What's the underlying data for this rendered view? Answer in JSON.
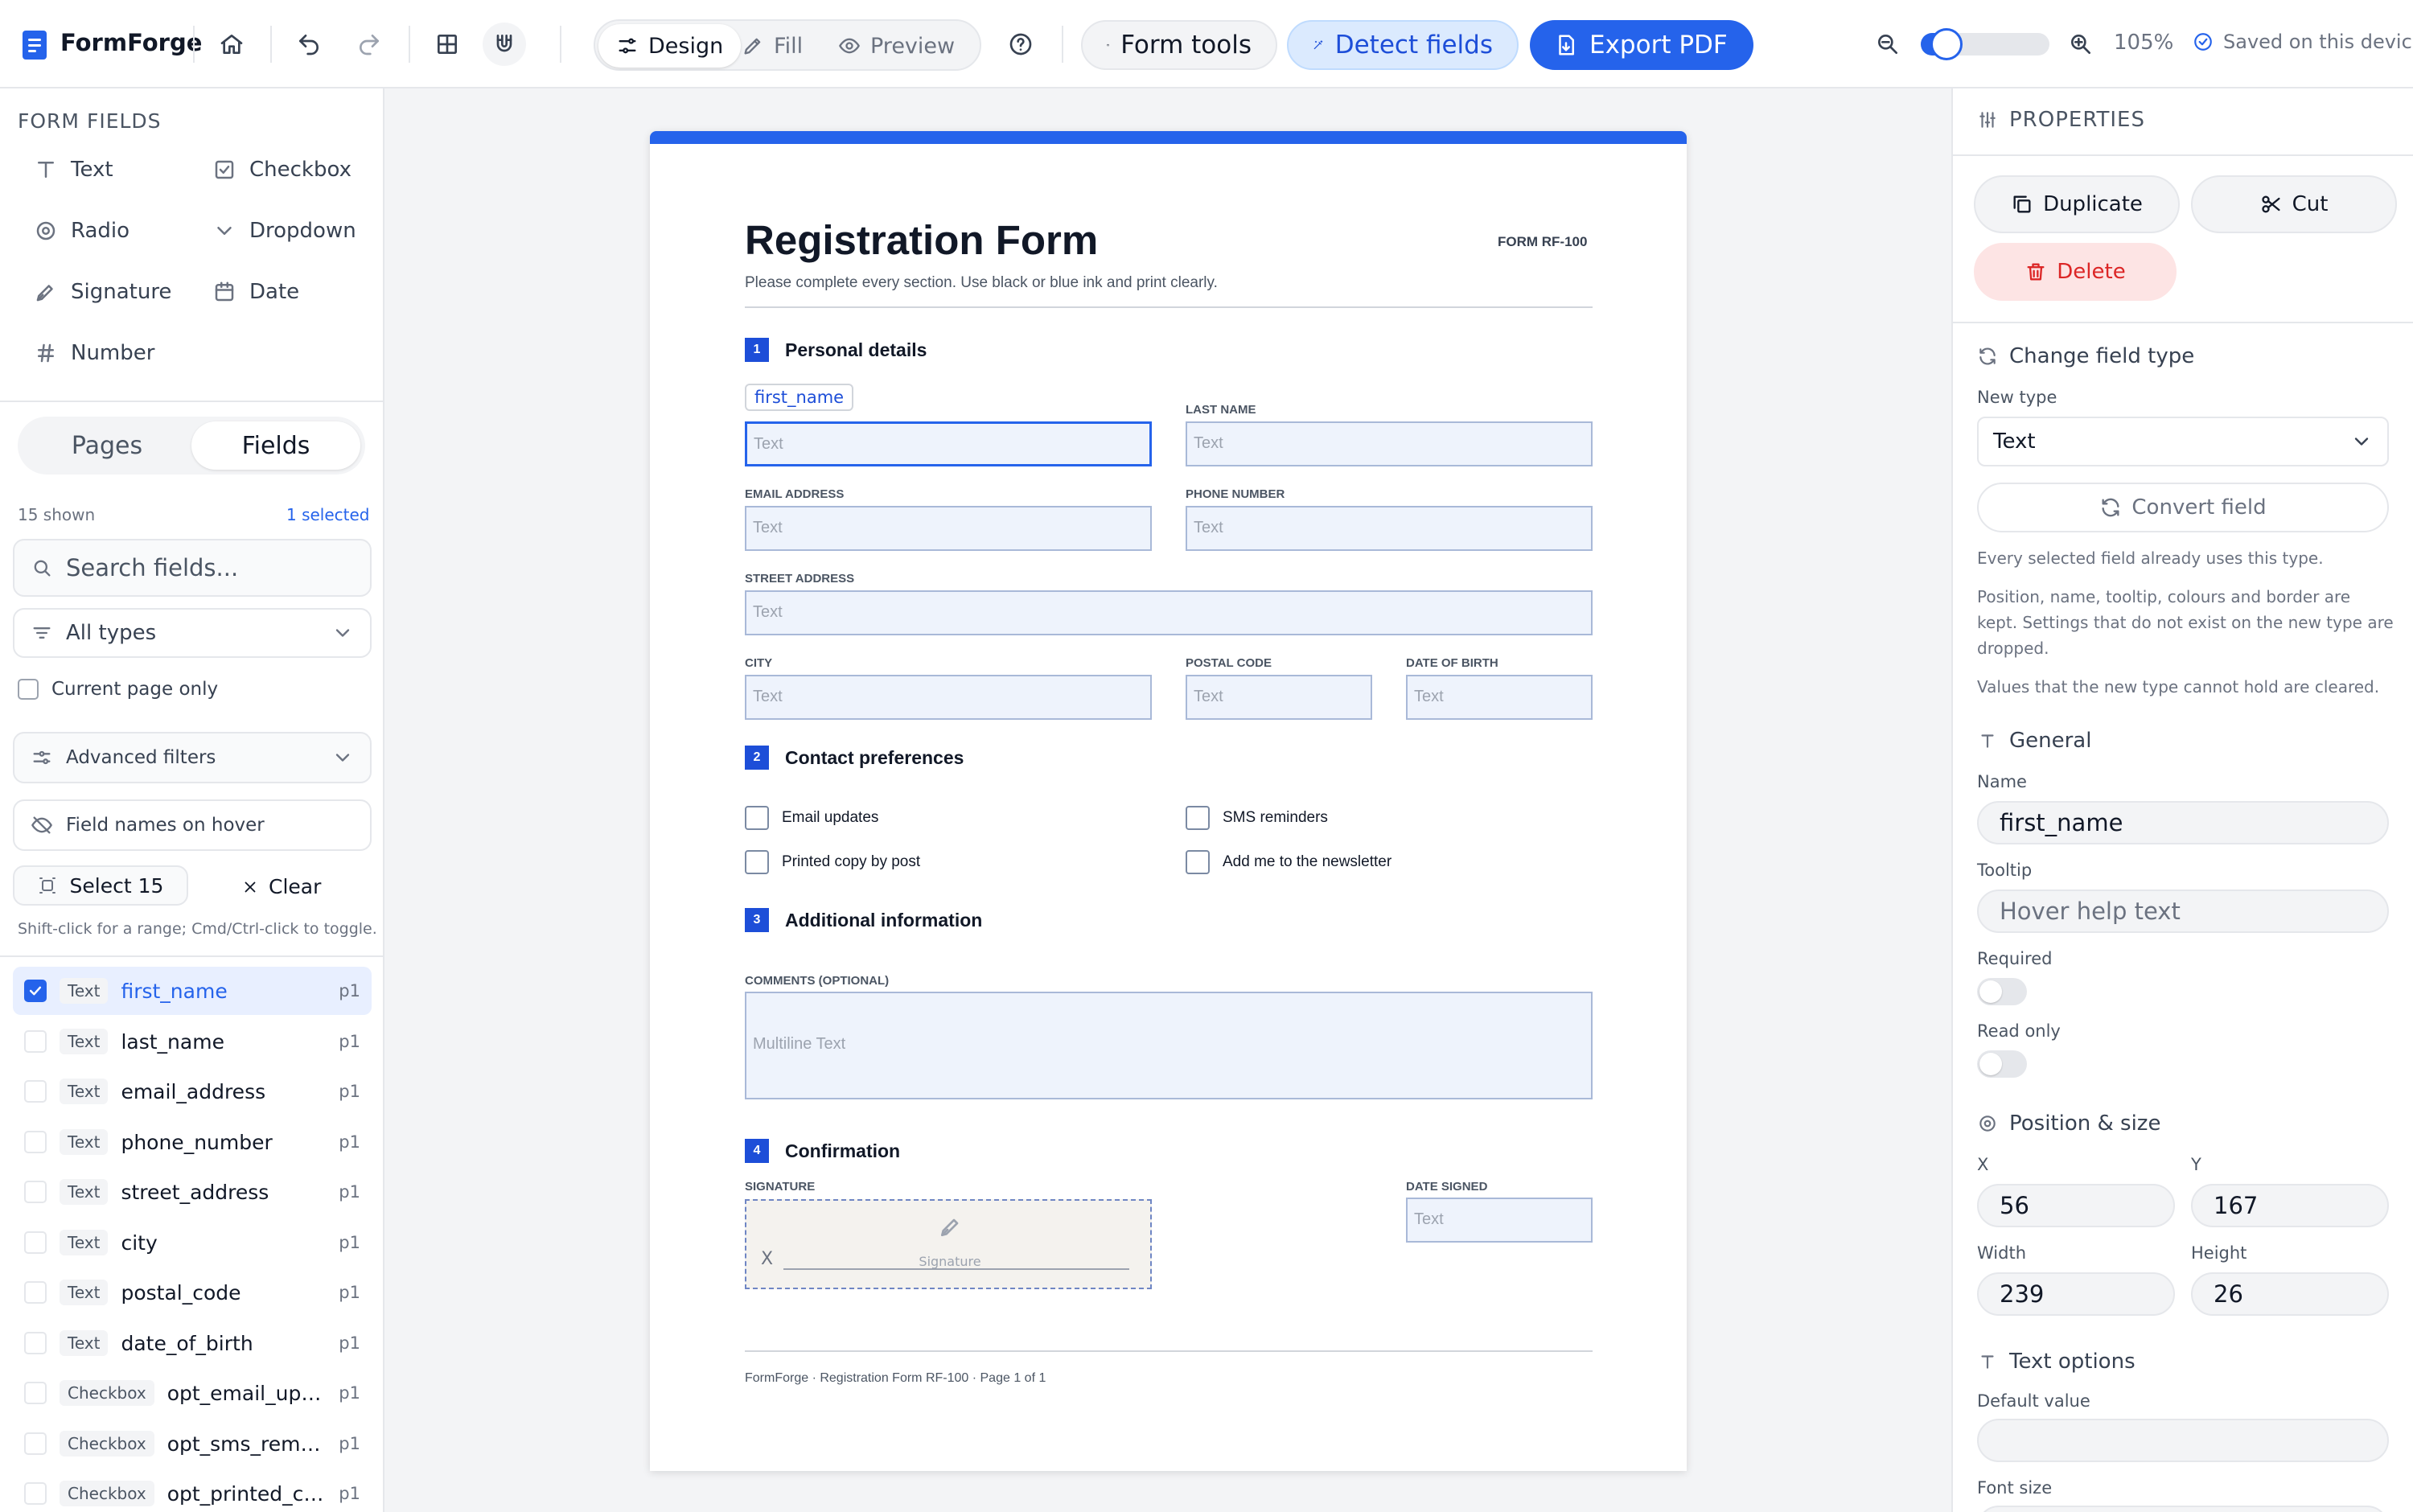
{
  "app": {
    "name": "FormForge"
  },
  "toolbar": {
    "modes": [
      "Design",
      "Fill",
      "Preview"
    ],
    "form_tools": "Form tools",
    "detect_fields": "Detect fields",
    "export_pdf": "Export PDF",
    "zoom_value": "105%",
    "zoom_slider_fraction": 0.15,
    "saved_status": "Saved on this device"
  },
  "left_panel": {
    "form_fields_title": "FORM FIELDS",
    "field_types": [
      "Text",
      "Checkbox",
      "Radio",
      "Dropdown",
      "Signature",
      "Date",
      "Number"
    ],
    "tabs": [
      "Pages",
      "Fields"
    ],
    "active_tab": "Fields",
    "shown_count": "15 shown",
    "selected_count": "1 selected",
    "search_placeholder": "Search fields...",
    "type_filter": "All types",
    "current_page_only": "Current page only",
    "advanced_filters": "Advanced filters",
    "field_names_hover": "Field names on hover",
    "select_all": "Select 15",
    "clear": "Clear",
    "hint": "Shift-click for a range; Cmd/Ctrl-click to toggle.",
    "fields": [
      {
        "type": "Text",
        "name": "first_name",
        "page": "p1",
        "selected": true
      },
      {
        "type": "Text",
        "name": "last_name",
        "page": "p1",
        "selected": false
      },
      {
        "type": "Text",
        "name": "email_address",
        "page": "p1",
        "selected": false
      },
      {
        "type": "Text",
        "name": "phone_number",
        "page": "p1",
        "selected": false
      },
      {
        "type": "Text",
        "name": "street_address",
        "page": "p1",
        "selected": false
      },
      {
        "type": "Text",
        "name": "city",
        "page": "p1",
        "selected": false
      },
      {
        "type": "Text",
        "name": "postal_code",
        "page": "p1",
        "selected": false
      },
      {
        "type": "Text",
        "name": "date_of_birth",
        "page": "p1",
        "selected": false
      },
      {
        "type": "Checkbox",
        "name": "opt_email_upd...",
        "page": "p1",
        "selected": false
      },
      {
        "type": "Checkbox",
        "name": "opt_sms_remin...",
        "page": "p1",
        "selected": false
      },
      {
        "type": "Checkbox",
        "name": "opt_printed_co...",
        "page": "p1",
        "selected": false
      }
    ]
  },
  "document": {
    "title": "Registration Form",
    "code": "FORM RF-100",
    "subtitle": "Please complete every section. Use black or blue ink and print clearly.",
    "selected_field_tag": "first_name",
    "sections": [
      {
        "num": "1",
        "title": "Personal details"
      },
      {
        "num": "2",
        "title": "Contact preferences"
      },
      {
        "num": "3",
        "title": "Additional information"
      },
      {
        "num": "4",
        "title": "Confirmation"
      }
    ],
    "labels": {
      "last_name": "LAST NAME",
      "email": "EMAIL ADDRESS",
      "phone": "PHONE NUMBER",
      "street": "STREET ADDRESS",
      "city": "CITY",
      "postal": "POSTAL CODE",
      "dob": "DATE OF BIRTH",
      "comments": "COMMENTS (OPTIONAL)",
      "signature": "SIGNATURE",
      "date_signed": "DATE SIGNED"
    },
    "placeholders": {
      "text": "Text",
      "multiline": "Multiline Text",
      "signature": "Signature",
      "signature_x": "X"
    },
    "checkboxes": [
      "Email updates",
      "SMS reminders",
      "Printed copy by post",
      "Add me to the newsletter"
    ],
    "footer": "FormForge · Registration Form RF-100 · Page 1 of 1"
  },
  "right_panel": {
    "title": "PROPERTIES",
    "duplicate": "Duplicate",
    "cut": "Cut",
    "delete": "Delete",
    "change_type_title": "Change field type",
    "new_type_label": "New type",
    "new_type_value": "Text",
    "convert": "Convert field",
    "notes": [
      "Every selected field already uses this type.",
      "Position, name, tooltip, colours and border are kept. Settings that do not exist on the new type are dropped.",
      "Values that the new type cannot hold are cleared."
    ],
    "general_title": "General",
    "name_label": "Name",
    "name_value": "first_name",
    "tooltip_label": "Tooltip",
    "tooltip_placeholder": "Hover help text",
    "required_label": "Required",
    "readonly_label": "Read only",
    "position_title": "Position & size",
    "x_label": "X",
    "x_value": "56",
    "y_label": "Y",
    "y_value": "167",
    "width_label": "Width",
    "width_value": "239",
    "height_label": "Height",
    "height_value": "26",
    "text_options_title": "Text options",
    "default_value_label": "Default value",
    "font_size_label": "Font size"
  },
  "colors": {
    "accent": "#2563eb",
    "danger": "#dc2626",
    "field_fill": "#eef3fc"
  }
}
